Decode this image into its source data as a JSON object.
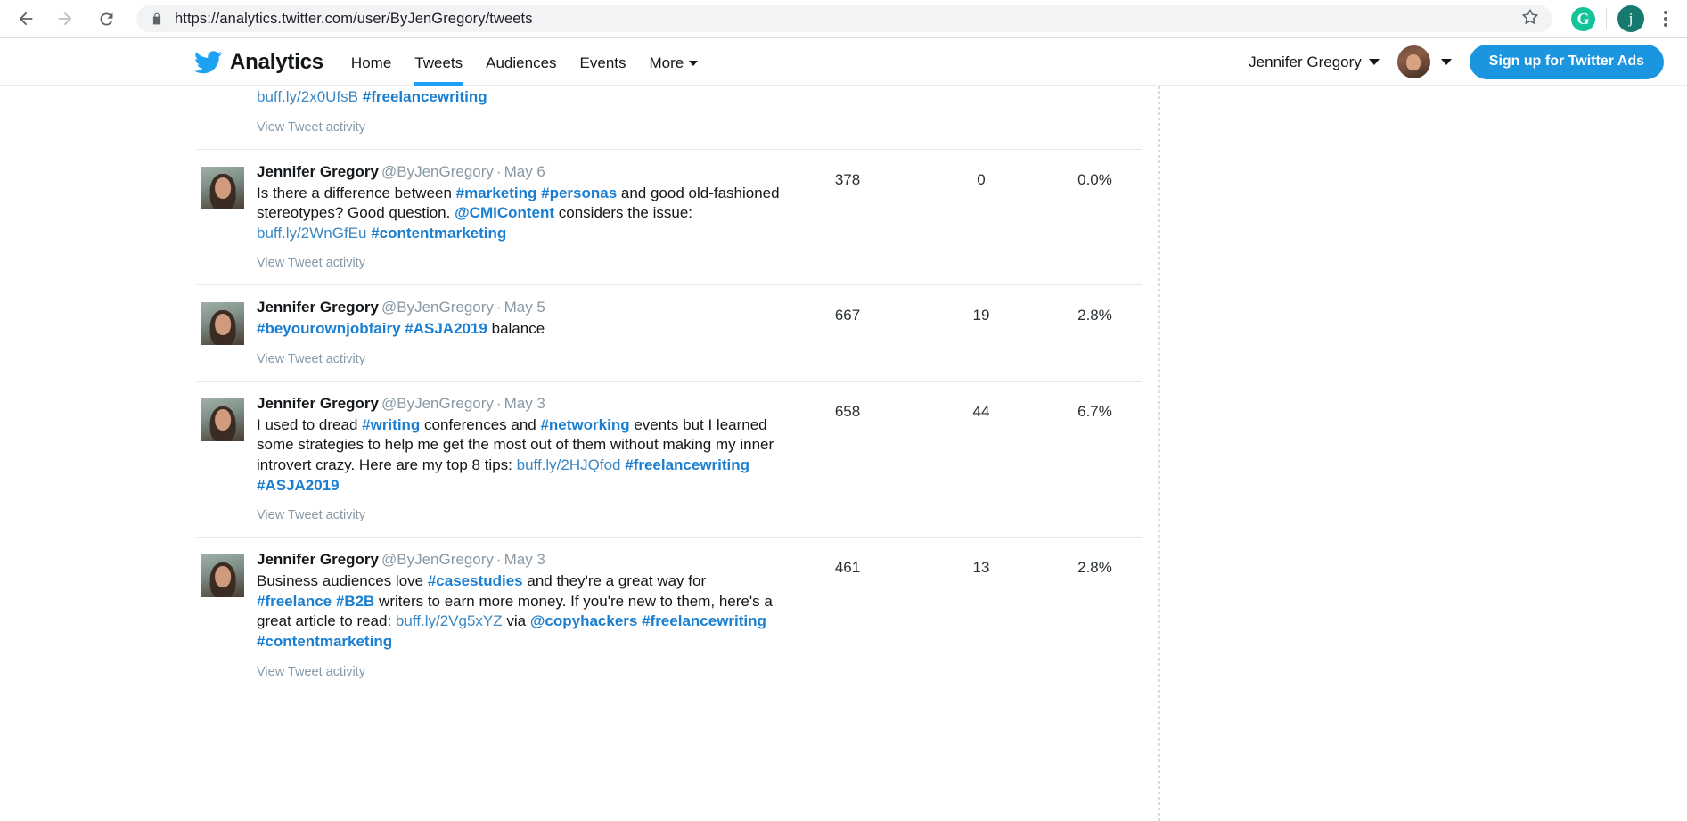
{
  "browser": {
    "back_icon": "back-arrow-icon",
    "forward_icon": "forward-arrow-icon",
    "reload_icon": "reload-icon",
    "lock_icon": "lock-icon",
    "url_scheme": "https://",
    "url_host": "analytics.twitter.com",
    "url_path": "/user/ByJenGregory/tweets",
    "url_full": "https://analytics.twitter.com/user/ByJenGregory/tweets",
    "star_icon": "bookmark-star-icon",
    "grammarly_label": "G",
    "profile_initial": "j",
    "menu_icon": "three-dot-menu-icon"
  },
  "header": {
    "logo_icon": "twitter-bird-icon",
    "brand": "Analytics",
    "nav": [
      {
        "label": "Home",
        "active": false
      },
      {
        "label": "Tweets",
        "active": true
      },
      {
        "label": "Audiences",
        "active": false
      },
      {
        "label": "Events",
        "active": false
      },
      {
        "label": "More",
        "active": false,
        "caret": true
      }
    ],
    "account_name": "Jennifer Gregory",
    "account_caret_icon": "chevron-down-icon",
    "avatar_icon": "user-avatar",
    "avatar_caret_icon": "chevron-down-icon",
    "signup_label": "Sign up for Twitter Ads",
    "signup_color": "#1b95e0"
  },
  "colors": {
    "link": "#3b88c3",
    "hashtag": "#1b7fd1",
    "accent": "#1da1f2",
    "text": "#14171a",
    "muted": "#8899a6",
    "border": "#e1e8ed"
  },
  "tweets": [
    {
      "partial": true,
      "author": "",
      "handle": "",
      "date": "",
      "segments": [
        {
          "t": "buff.ly/2x0UfsB",
          "k": "url"
        },
        {
          "t": " ",
          "k": "plain"
        },
        {
          "t": "#freelancewriting",
          "k": "tag"
        }
      ],
      "view_activity": "View Tweet activity",
      "impressions": "",
      "engagements": "",
      "rate": ""
    },
    {
      "partial": false,
      "author": "Jennifer Gregory",
      "handle": "@ByJenGregory",
      "date": "May 6",
      "segments": [
        {
          "t": "Is there a difference between ",
          "k": "plain"
        },
        {
          "t": "#marketing",
          "k": "tag"
        },
        {
          "t": " ",
          "k": "plain"
        },
        {
          "t": "#personas",
          "k": "tag"
        },
        {
          "t": " and good old-fashioned stereotypes? Good question. ",
          "k": "plain"
        },
        {
          "t": "@CMIContent",
          "k": "tag"
        },
        {
          "t": " considers the issue: ",
          "k": "plain"
        },
        {
          "t": "buff.ly/2WnGfEu",
          "k": "url"
        },
        {
          "t": " ",
          "k": "plain"
        },
        {
          "t": "#contentmarketing",
          "k": "tag"
        }
      ],
      "view_activity": "View Tweet activity",
      "impressions": "378",
      "engagements": "0",
      "rate": "0.0%"
    },
    {
      "partial": false,
      "author": "Jennifer Gregory",
      "handle": "@ByJenGregory",
      "date": "May 5",
      "segments": [
        {
          "t": "#beyourownjobfairy",
          "k": "tag"
        },
        {
          "t": " ",
          "k": "plain"
        },
        {
          "t": "#ASJA2019",
          "k": "tag"
        },
        {
          "t": "  balance",
          "k": "plain"
        }
      ],
      "view_activity": "View Tweet activity",
      "impressions": "667",
      "engagements": "19",
      "rate": "2.8%"
    },
    {
      "partial": false,
      "author": "Jennifer Gregory",
      "handle": "@ByJenGregory",
      "date": "May 3",
      "segments": [
        {
          "t": "I used to dread ",
          "k": "plain"
        },
        {
          "t": "#writing",
          "k": "tag"
        },
        {
          "t": " conferences and ",
          "k": "plain"
        },
        {
          "t": "#networking",
          "k": "tag"
        },
        {
          "t": " events but I learned some strategies to help me get the most out of them without making my inner introvert crazy. Here are my top 8 tips: ",
          "k": "plain"
        },
        {
          "t": "buff.ly/2HJQfod",
          "k": "url"
        },
        {
          "t": " ",
          "k": "plain"
        },
        {
          "t": "#freelancewriting",
          "k": "tag"
        },
        {
          "t": " ",
          "k": "plain"
        },
        {
          "t": "#ASJA2019",
          "k": "tag"
        }
      ],
      "view_activity": "View Tweet activity",
      "impressions": "658",
      "engagements": "44",
      "rate": "6.7%"
    },
    {
      "partial": false,
      "author": "Jennifer Gregory",
      "handle": "@ByJenGregory",
      "date": "May 3",
      "segments": [
        {
          "t": "Business audiences love ",
          "k": "plain"
        },
        {
          "t": "#casestudies",
          "k": "tag"
        },
        {
          "t": " and they're a great way for ",
          "k": "plain"
        },
        {
          "t": "#freelance",
          "k": "tag"
        },
        {
          "t": " ",
          "k": "plain"
        },
        {
          "t": "#B2B",
          "k": "tag"
        },
        {
          "t": " writers to earn more money. If you're new to them, here's a great article to read: ",
          "k": "plain"
        },
        {
          "t": "buff.ly/2Vg5xYZ",
          "k": "url"
        },
        {
          "t": " via ",
          "k": "plain"
        },
        {
          "t": "@copyhackers",
          "k": "tag"
        },
        {
          "t": " ",
          "k": "plain"
        },
        {
          "t": "#freelancewriting",
          "k": "tag"
        },
        {
          "t": " ",
          "k": "plain"
        },
        {
          "t": "#contentmarketing",
          "k": "tag"
        }
      ],
      "view_activity": "View Tweet activity",
      "impressions": "461",
      "engagements": "13",
      "rate": "2.8%"
    }
  ]
}
